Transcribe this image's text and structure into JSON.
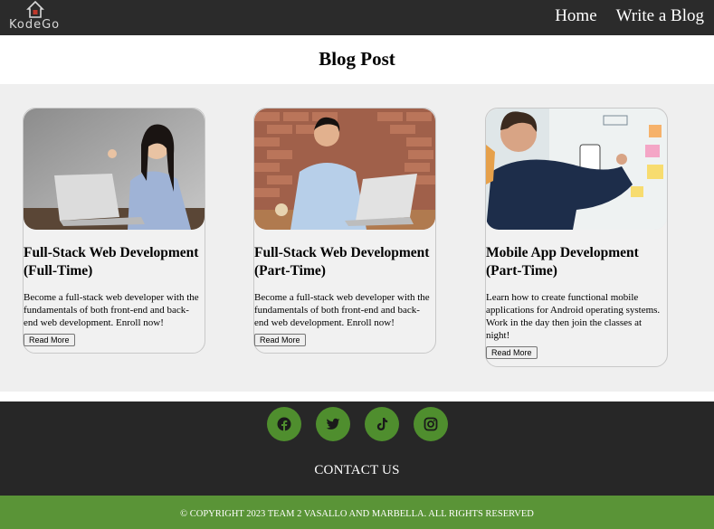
{
  "nav": {
    "logo_text": "KodeGo",
    "links": [
      "Home",
      "Write a Blog"
    ]
  },
  "page": {
    "title": "Blog Post"
  },
  "cards": [
    {
      "title": "Full-Stack Web Development (Full-Time)",
      "description": "Become a full-stack web developer with the fundamentals of both front-end and back-end web development. Enroll now!",
      "button": "Read More"
    },
    {
      "title": "Full-Stack Web Development (Part-Time)",
      "description": "Become a full-stack web developer with the fundamentals of both front-end and back-end web development. Enroll now!",
      "button": "Read More"
    },
    {
      "title": "Mobile App Development (Part-Time)",
      "description": "Learn how to create functional mobile applications for Android operating systems. Work in the day then join the classes at night!",
      "button": "Read More"
    }
  ],
  "footer": {
    "social": [
      "facebook-icon",
      "twitter-icon",
      "tiktok-icon",
      "instagram-icon"
    ],
    "contact_label": "CONTACT US",
    "copyright": "© COPYRIGHT 2023 TEAM 2 VASALLO AND MARBELLA. ALL RIGHTS RESERVED"
  },
  "colors": {
    "nav_bg": "#2b2b2b",
    "footer_bg": "#272727",
    "accent_green": "#5a9437",
    "social_green": "#4f8e2e",
    "cards_bg": "#efefef"
  }
}
